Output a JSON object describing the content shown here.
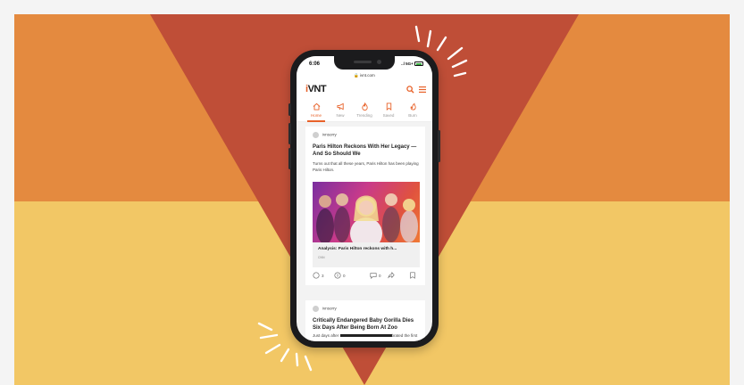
{
  "colors": {
    "top_band": "#e48a3f",
    "bottom_band": "#f2c765",
    "triangle": "#bf4e37",
    "accent": "#e8622a"
  },
  "phone": {
    "status_time": "6:06",
    "status_signal": "..l 5G+",
    "url": "ivnt.com",
    "logo_text": "VNT",
    "logo_mark": "i",
    "tabs": [
      {
        "label": "Home",
        "icon": "home-icon",
        "active": true
      },
      {
        "label": "New",
        "icon": "megaphone-icon",
        "active": false
      },
      {
        "label": "Trending",
        "icon": "trending-icon",
        "active": false
      },
      {
        "label": "Saved",
        "icon": "bookmark-icon",
        "active": false
      },
      {
        "label": "Burn",
        "icon": "burn-icon",
        "active": false
      }
    ],
    "post1": {
      "author": "ivnsorry",
      "title": "Paris Hilton Reckons With Her Legacy — And So Should We",
      "excerpt": "Turns out that all these years, Paris Hilton has been playing Paris Hilton.",
      "image_caption": "Analysis: Paris Hilton reckons with h...",
      "image_source": "CNN",
      "likes": "3",
      "upvotes": "0",
      "comments": "0"
    },
    "post2": {
      "author": "ivnsorry",
      "title": "Critically Endangered Baby Gorilla Dies Six Days After Being Born At Zoo",
      "excerpt_start": "Just days after",
      "excerpt_end": "brated the first"
    }
  }
}
